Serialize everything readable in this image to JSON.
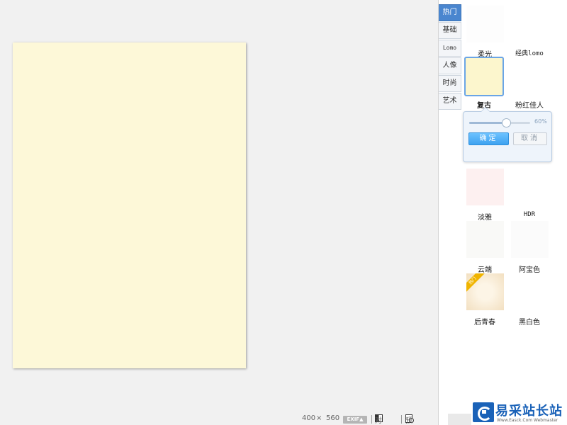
{
  "canvas": {
    "background": "#fdf8d8"
  },
  "status": {
    "width": "400",
    "times": "×",
    "height": "560",
    "exif_label": "EXIF▲",
    "compare_label": "对比",
    "preview_label": "预览"
  },
  "tabs": [
    "热门",
    "基础",
    "Lomo",
    "人像",
    "时尚",
    "艺术"
  ],
  "filters": {
    "f1": {
      "label": "柔光"
    },
    "f2": {
      "label": "经典lomo"
    },
    "f3": {
      "label": "复古"
    },
    "f4": {
      "label": "粉红佳人"
    },
    "f5": {
      "label": "淡雅"
    },
    "f6": {
      "label": "HDR"
    },
    "f7": {
      "label": "云端"
    },
    "f8": {
      "label": "阿宝色"
    },
    "f9": {
      "label": "后青春",
      "badge": "热门"
    },
    "f10": {
      "label": "黑白色"
    }
  },
  "popup": {
    "intensity": 60,
    "intensity_text": "60%",
    "ok_label": "确定",
    "cancel_label": "取消"
  },
  "watermark": {
    "title": "易采站长站",
    "url": "Www.Easck.Com Webmaster"
  },
  "colors": {
    "tab_active": "#4a86cf",
    "accent": "#3ea2f0",
    "selected_border": "#6aa5e6"
  }
}
